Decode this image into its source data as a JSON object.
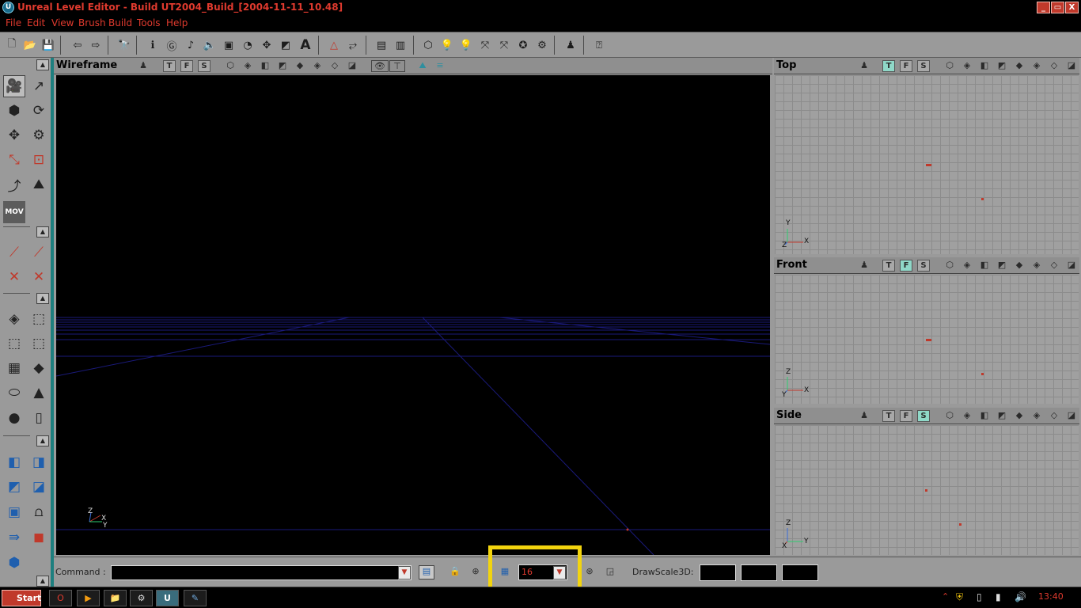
{
  "titlebar": {
    "title": "Unreal Level Editor - Build UT2004_Build_[2004-11-11_10.48]",
    "buttons": [
      "_",
      "▭",
      "X"
    ]
  },
  "menu": [
    "File",
    "Edit",
    "View",
    "Brush",
    "Build",
    "Tools",
    "Help"
  ],
  "viewports": {
    "main": {
      "title": "Wireframe"
    },
    "top": {
      "title": "Top",
      "active_button": "T"
    },
    "front": {
      "title": "Front",
      "active_button": "F"
    },
    "side": {
      "title": "Side",
      "active_button": "S"
    },
    "tfs": [
      "T",
      "F",
      "S"
    ]
  },
  "axes": {
    "top": [
      "Y",
      "Z",
      "X"
    ],
    "front": [
      "Z",
      "Y",
      "X"
    ],
    "side": [
      "Z",
      "X",
      "Y"
    ],
    "main": [
      "Z",
      "X",
      "Y"
    ]
  },
  "bottombar": {
    "command_label": "Command :",
    "command_value": "",
    "grid_size": "16",
    "drawscale_label": "DrawScale3D:"
  },
  "taskbar": {
    "start_label": "Start",
    "clock": "13:40"
  },
  "colors": {
    "accent_red": "#e03a2e",
    "panel_gray": "#9a9a9a",
    "teal": "#1d7f7f",
    "highlight": "#f2d40e"
  }
}
